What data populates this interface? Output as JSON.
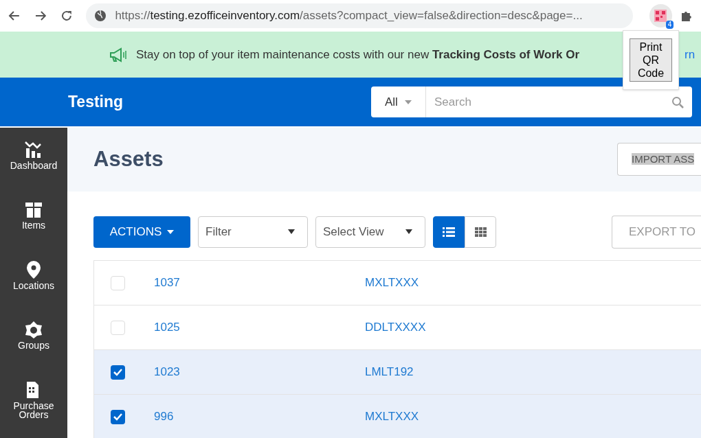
{
  "browser": {
    "url_host": "testing.ezofficeinventory.com",
    "url_scheme": "https://",
    "url_path": "/assets?compact_view=false&direction=desc&page=...",
    "extension_badge": "4",
    "popup_button": "Print QR Code"
  },
  "banner": {
    "text": "Stay on top of your item maintenance costs with our new **Tracking Costs of Work Or**",
    "link": "rn"
  },
  "header": {
    "company": "Testing",
    "scope": "All",
    "search_placeholder": "Search"
  },
  "sidebar": {
    "items": [
      {
        "label": "Dashboard",
        "kind": "dashboard"
      },
      {
        "label": "Items",
        "kind": "items"
      },
      {
        "label": "Locations",
        "kind": "locations"
      },
      {
        "label": "Groups",
        "kind": "groups"
      },
      {
        "label": "Purchase Orders",
        "kind": "orders"
      }
    ]
  },
  "page": {
    "title": "Assets",
    "import_button": "IMPORT ASS",
    "actions_button": "ACTIONS",
    "filter": "Filter",
    "view_select": "Select View",
    "view_modes": [
      {
        "kind": "list",
        "selected": true
      },
      {
        "kind": "grid",
        "selected": false
      }
    ],
    "export_button": "EXPORT TO"
  },
  "table": {
    "rows": [
      {
        "id": "1037",
        "code": "MXLTXXX",
        "checked": false
      },
      {
        "id": "1025",
        "code": "DDLTXXXX",
        "checked": false
      },
      {
        "id": "1023",
        "code": "LMLT192",
        "checked": true
      },
      {
        "id": "996",
        "code": "MXLTXXX",
        "checked": true
      }
    ]
  }
}
